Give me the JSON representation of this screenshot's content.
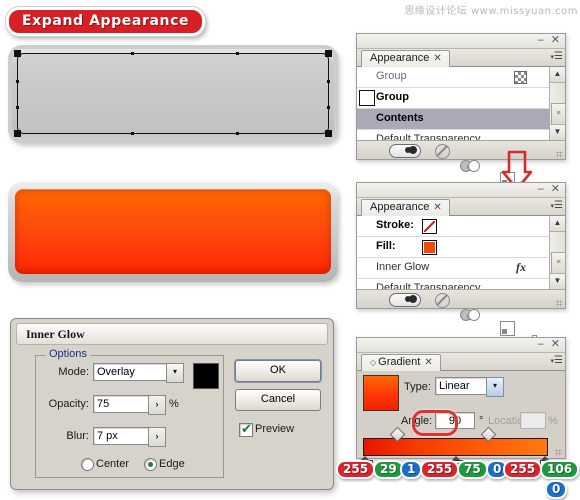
{
  "watermark": "思缘设计论坛 www.missyuan.com",
  "title_badge": {
    "label": "Expand Appearance",
    "bg": "#d81f26"
  },
  "artwork": {
    "grey_button": {
      "name": "rounded-bar-shape-grey",
      "fill": "#c6c6c6"
    },
    "orange_button": {
      "name": "rounded-bar-shape-orange",
      "fill_top": "#ff6a00",
      "fill_bottom": "#f02000"
    }
  },
  "arrow": {
    "name": "down-arrow",
    "color": "#d82a2a"
  },
  "appearance_panel_1": {
    "tab": "Appearance",
    "tab_close": "✕",
    "minimize": "–",
    "close": "✕",
    "rows": [
      {
        "label": "Group",
        "bold": false,
        "icon": "checkerboard",
        "swatch": null
      },
      {
        "label": "Group",
        "bold": true,
        "icon": null,
        "swatch": "#ffffff"
      },
      {
        "label": "Contents",
        "bold": true,
        "selected": true,
        "icon": null,
        "swatch": null
      },
      {
        "label": "Default Transparency",
        "bold": false,
        "icon": null,
        "swatch": null
      }
    ],
    "footer_icons": [
      "opacity-pill",
      "no-stroke",
      "gradient-circles",
      "duplicate-item",
      "delete-item"
    ]
  },
  "appearance_panel_2": {
    "tab": "Appearance",
    "tab_close": "✕",
    "minimize": "–",
    "close": "✕",
    "rows": [
      {
        "label": "Stroke:",
        "swatch": "none",
        "swatch_color": "#ffffff"
      },
      {
        "label": "Fill:",
        "swatch": "color",
        "swatch_color": "#f44a0a"
      },
      {
        "label": "Inner Glow",
        "fx": "fx"
      },
      {
        "label": "Default Transparency"
      }
    ],
    "footer_icons": [
      "opacity-pill",
      "no-stroke",
      "gradient-circles",
      "duplicate-item",
      "delete-item"
    ]
  },
  "inner_glow_dialog": {
    "title": "Inner Glow",
    "legend": "Options",
    "mode_label": "Mode:",
    "mode_value": "Overlay",
    "glow_color": "#000000",
    "opacity_label": "Opacity:",
    "opacity_value": "75",
    "opacity_unit": "%",
    "blur_label": "Blur:",
    "blur_value": "7 px",
    "radio_center": "Center",
    "radio_edge": "Edge",
    "radio_selected": "Edge",
    "ok_label": "OK",
    "cancel_label": "Cancel",
    "preview_label": "Preview",
    "preview_checked": true,
    "spinner_glyph": "›",
    "dropdown_glyph": "▾"
  },
  "gradient_panel": {
    "tab": "Gradient",
    "tab_diamond": "◇",
    "tab_close": "✕",
    "minimize": "–",
    "close": "✕",
    "type_label": "Type:",
    "type_value": "Linear",
    "angle_label": "Angle:",
    "angle_value": "90",
    "angle_unit": "°",
    "location_label": "Location:",
    "location_value": "",
    "location_unit": "%",
    "dropdown_glyph": "▾",
    "stops": [
      {
        "position": 0,
        "color": "#e81500"
      },
      {
        "position": 50,
        "color": "#f95a10"
      },
      {
        "position": 100,
        "color": "#ff8a28"
      }
    ],
    "midpoints": [
      18,
      68
    ]
  },
  "rgb_readouts": [
    {
      "r": "255",
      "g": "29",
      "b": "1"
    },
    {
      "r": "255",
      "g": "75",
      "b": "0"
    },
    {
      "r": "255",
      "g": "106",
      "b": "0"
    }
  ]
}
